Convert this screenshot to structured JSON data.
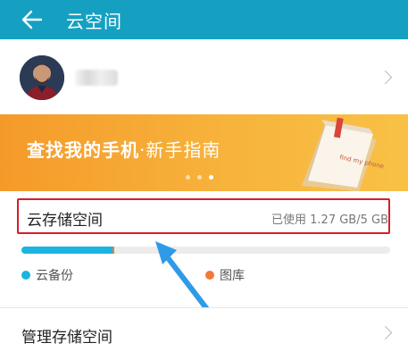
{
  "appbar": {
    "title": "云空间",
    "back_icon": "back-arrow-icon"
  },
  "profile": {
    "chevron_icon": "chevron-right-icon"
  },
  "banner": {
    "title": "查找我的手机",
    "separator": "·",
    "subtitle": "新手指南",
    "dots_count": 3,
    "active_dot": 3,
    "book_text": "find my phone"
  },
  "storage": {
    "label": "云存储空间",
    "usage_text": "已使用 1.27 GB/5 GB",
    "used_fraction": 0.254,
    "legend": [
      {
        "label": "云备份",
        "color": "#19b5e0"
      },
      {
        "label": "图库",
        "color": "#f07a37"
      }
    ]
  },
  "manage": {
    "label": "管理存储空间",
    "chevron_icon": "chevron-right-icon"
  },
  "colors": {
    "appbar": "#15a0c2",
    "highlight": "#d61e26",
    "banner": "#f7b33c",
    "arrow": "#2f9be8"
  }
}
